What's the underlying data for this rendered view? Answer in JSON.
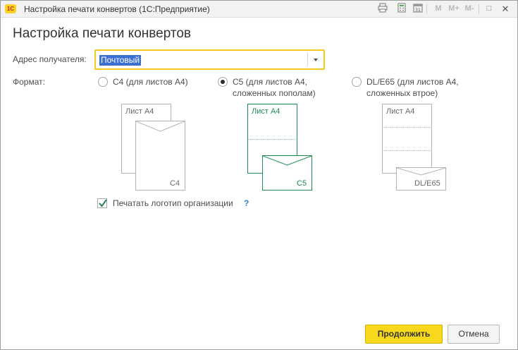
{
  "window": {
    "logo_text": "1С",
    "title": "Настройка печати конвертов  (1С:Предприятие)",
    "toolbar": {
      "memory_label": "M",
      "memory_plus_label": "M+",
      "memory_minus_label": "M-",
      "minimize_glyph": "□",
      "close_glyph": "✕"
    }
  },
  "form": {
    "heading": "Настройка печати конвертов",
    "recipient_address": {
      "label": "Адрес получателя:",
      "value": "Почтовый"
    },
    "format": {
      "label": "Формат:",
      "options": [
        {
          "line1": "C4 (для листов А4)",
          "line2": "",
          "selected": false
        },
        {
          "line1": "C5 (для листов А4,",
          "line2": "сложенных пополам)",
          "selected": true
        },
        {
          "line1": "DL/E65 (для листов А4,",
          "line2": "сложенных втрое)",
          "selected": false
        }
      ]
    },
    "illustrations": {
      "c4": {
        "sheet_label": "Лист А4",
        "envelope_label": "C4"
      },
      "c5": {
        "sheet_label": "Лист А4",
        "envelope_label": "C5"
      },
      "dl": {
        "sheet_label": "Лист А4",
        "envelope_label": "DL/E65"
      }
    },
    "print_logo": {
      "label": "Печатать логотип организации",
      "checked": true,
      "help": "?"
    }
  },
  "footer": {
    "continue_label": "Продолжить",
    "cancel_label": "Отмена"
  },
  "colors": {
    "accent_yellow": "#f8d81c",
    "selected_green": "#1e8a52",
    "link_blue": "#3b77c4",
    "selection_blue": "#3b6fd1"
  }
}
